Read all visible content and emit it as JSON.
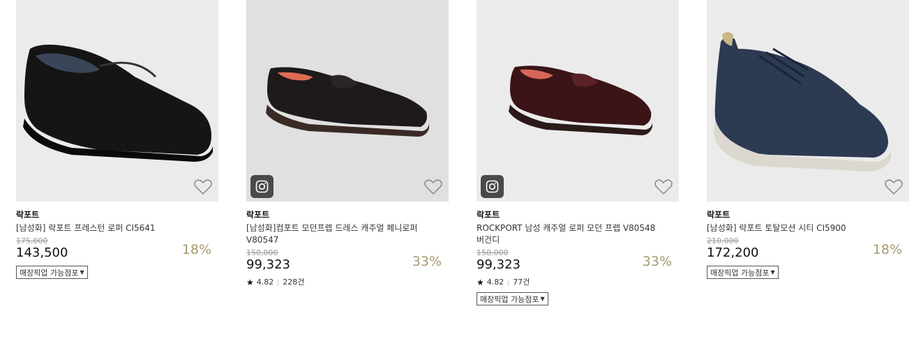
{
  "products": [
    {
      "brand": "락포트",
      "name": "[남성화] 락포트 프레스턴 로퍼 CI5641",
      "original_price": "175,000",
      "price": "143,500",
      "discount": "18%",
      "pickup_label": "매장픽업 가능점포",
      "shoe_color": "#151515"
    },
    {
      "brand": "락포트",
      "name": "[남성화]컴포트 모던프렙 드레스 캐주얼 페니로퍼 V80547",
      "original_price": "150,000",
      "price": "99,323",
      "discount": "33%",
      "rating": "4.82",
      "reviews": "228건",
      "shoe_color": "#1e1a1c"
    },
    {
      "brand": "락포트",
      "name": "ROCKPORT 남성 캐주얼 로퍼 모던 프렙 V80548 버건디",
      "original_price": "150,000",
      "price": "99,323",
      "discount": "33%",
      "rating": "4.82",
      "reviews": "77건",
      "pickup_label": "매장픽업 가능점포",
      "shoe_color": "#3a1416"
    },
    {
      "brand": "락포트",
      "name": "[남성화] 락포트 토탈모션 시티 CI5900",
      "original_price": "210,000",
      "price": "172,200",
      "discount": "18%",
      "pickup_label": "매장픽업 가능점포",
      "shoe_color": "#2c3a52"
    }
  ],
  "colors": {
    "discount": "#a79a6c",
    "thumb_bg": "#ebebeb"
  }
}
